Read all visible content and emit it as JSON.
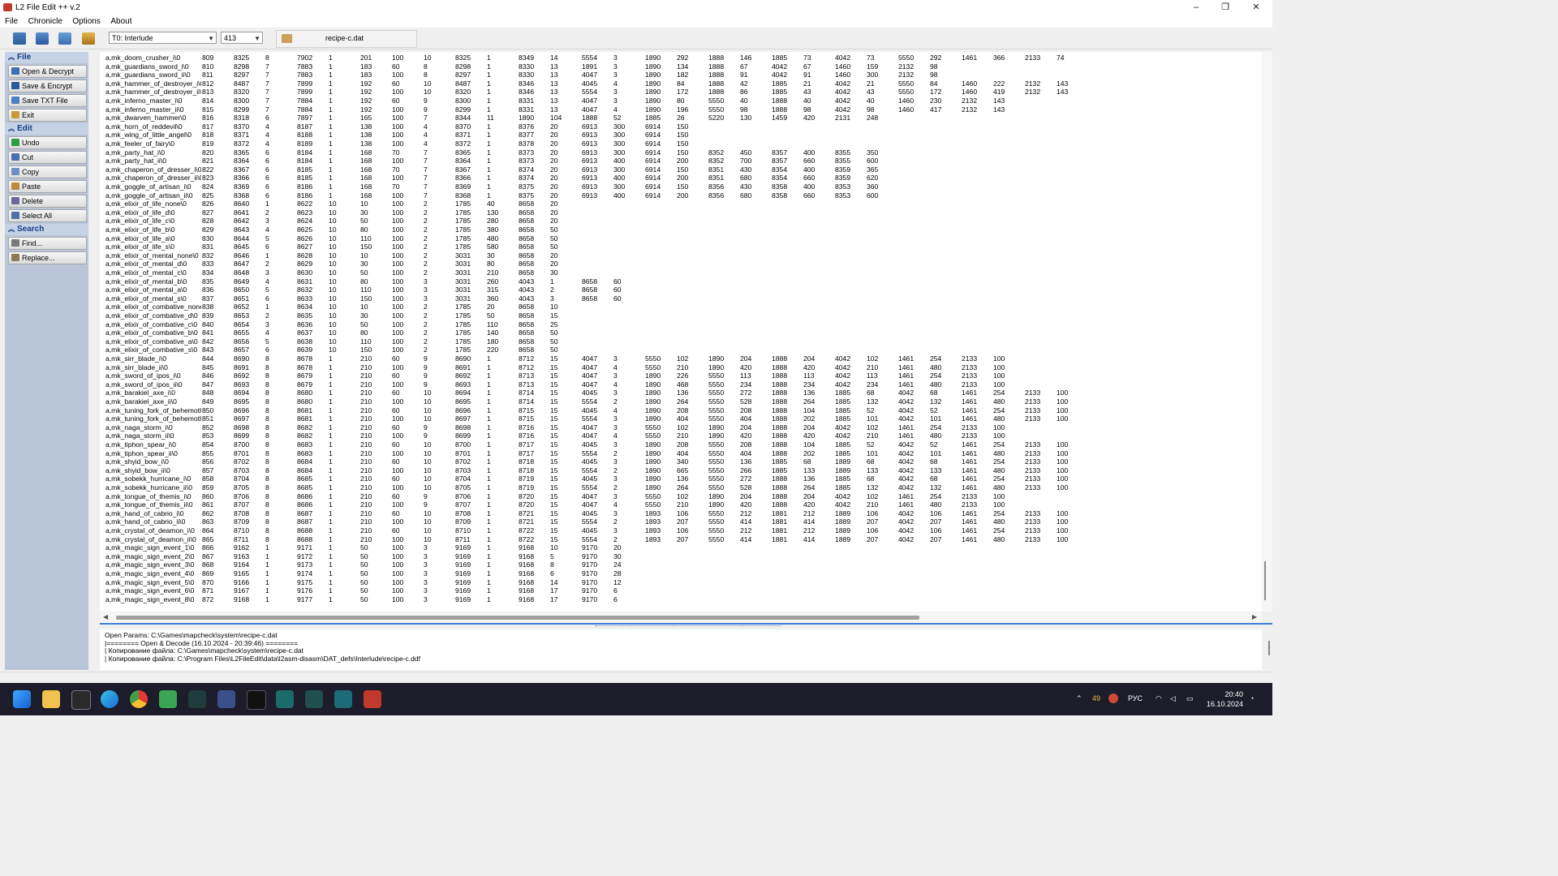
{
  "window": {
    "title": "L2 File Edit ++ v.2",
    "controls": [
      "–",
      "❐",
      "✕"
    ]
  },
  "menu": [
    "File",
    "Chronicle",
    "Options",
    "About"
  ],
  "toolbar": {
    "chronicle_select": "T0: Interlude",
    "count_select": "413",
    "filename": "recipe-c.dat"
  },
  "sidebar": {
    "sections": [
      {
        "title": "File",
        "items": [
          "Open & Decrypt",
          "Save & Encrypt",
          "Save TXT File",
          "Exit"
        ]
      },
      {
        "title": "Edit",
        "items": [
          "Undo",
          "Cut",
          "Copy",
          "Paste",
          "Delete",
          "Select All"
        ]
      },
      {
        "title": "Search",
        "items": [
          "Find...",
          "Replace..."
        ]
      }
    ]
  },
  "rows": [
    "a,mk_doom_crusher_i\\0\t809\t8325\t8\t7902\t1\t201\t100\t10\t8325\t1\t8349\t14\t5554\t3\t1890\t292\t1888\t146\t1885\t73\t4042\t73\t5550\t292\t1461\t366\t2133\t74",
    "a,mk_guardians_sword_i\\0\t810\t8298\t7\t7883\t1\t183\t60\t8\t8298\t1\t8330\t13\t1891\t3\t1890\t134\t1888\t67\t4042\t67\t1460\t159\t2132\t98",
    "a,mk_guardians_sword_ii\\0\t811\t8297\t7\t7883\t1\t183\t100\t8\t8297\t1\t8330\t13\t4047\t3\t1890\t182\t1888\t91\t4042\t91\t1460\t300\t2132\t98",
    "a,mk_hammer_of_destroyer_i\\0\t812\t8487\t7\t7899\t1\t192\t60\t10\t8487\t1\t8346\t13\t4045\t4\t1890\t84\t1888\t42\t1885\t21\t4042\t21\t5550\t84\t1460\t222\t2132\t143",
    "a,mk_hammer_of_destroyer_ii\\0\t813\t8320\t7\t7899\t1\t192\t100\t10\t8320\t1\t8346\t13\t5554\t3\t1890\t172\t1888\t86\t1885\t43\t4042\t43\t5550\t172\t1460\t419\t2132\t143",
    "a,mk_inferno_master_i\\0\t814\t8300\t7\t7884\t1\t192\t60\t9\t8300\t1\t8331\t13\t4047\t3\t1890\t80\t5550\t40\t1888\t40\t4042\t40\t1460\t230\t2132\t143",
    "a,mk_inferno_master_ii\\0\t815\t8299\t7\t7884\t1\t192\t100\t9\t8299\t1\t8331\t13\t4047\t4\t1890\t196\t5550\t98\t1888\t98\t4042\t98\t1460\t417\t2132\t143",
    "a,mk_dwarven_hammer\\0\t816\t8318\t6\t7897\t1\t165\t100\t7\t8344\t11\t1890\t104\t1888\t52\t1885\t26\t5220\t130\t1459\t420\t2131\t248",
    "a,mk_horn_of_reddevil\\0\t817\t8370\t4\t8187\t1\t138\t100\t4\t8370\t1\t8376\t20\t6913\t300\t6914\t150",
    "a,mk_wing_of_little_angel\\0\t818\t8371\t4\t8188\t1\t138\t100\t4\t8371\t1\t8377\t20\t6913\t300\t6914\t150",
    "a,mk_feeler_of_fairy\\0\t819\t8372\t4\t8189\t1\t138\t100\t4\t8372\t1\t8378\t20\t6913\t300\t6914\t150",
    "a,mk_party_hat_i\\0\t820\t8365\t6\t8184\t1\t168\t70\t7\t8365\t1\t8373\t20\t6913\t300\t6914\t150\t8352\t450\t8357\t400\t8355\t350",
    "a,mk_party_hat_ii\\0\t821\t8364\t6\t8184\t1\t168\t100\t7\t8364\t1\t8373\t20\t6913\t400\t6914\t200\t8352\t700\t8357\t660\t8355\t600",
    "a,mk_chaperon_of_dresser_i\\0\t822\t8367\t6\t8185\t1\t168\t70\t7\t8367\t1\t8374\t20\t6913\t300\t6914\t150\t8351\t430\t8354\t400\t8359\t365",
    "a,mk_chaperon_of_dresser_ii\\0\t823\t8366\t6\t8185\t1\t168\t100\t7\t8366\t1\t8374\t20\t6913\t400\t6914\t200\t8351\t680\t8354\t660\t8359\t620",
    "a,mk_goggle_of_artisan_i\\0\t824\t8369\t6\t8186\t1\t168\t70\t7\t8369\t1\t8375\t20\t6913\t300\t6914\t150\t8356\t430\t8358\t400\t8353\t360",
    "a,mk_goggle_of_artisan_ii\\0\t825\t8368\t6\t8186\t1\t168\t100\t7\t8368\t1\t8375\t20\t6913\t400\t6914\t200\t8356\t680\t8358\t660\t8353\t600",
    "a,mk_elixir_of_life_none\\0\t826\t8640\t1\t8622\t10\t10\t100\t2\t1785\t40\t8658\t20",
    "a,mk_elixir_of_life_d\\0\t827\t8641\t2\t8623\t10\t30\t100\t2\t1785\t130\t8658\t20",
    "a,mk_elixir_of_life_c\\0\t828\t8642\t3\t8624\t10\t50\t100\t2\t1785\t280\t8658\t20",
    "a,mk_elixir_of_life_b\\0\t829\t8643\t4\t8625\t10\t80\t100\t2\t1785\t380\t8658\t50",
    "a,mk_elixir_of_life_a\\0\t830\t8644\t5\t8626\t10\t110\t100\t2\t1785\t480\t8658\t50",
    "a,mk_elixir_of_life_s\\0\t831\t8645\t6\t8627\t10\t150\t100\t2\t1785\t580\t8658\t50",
    "a,mk_elixir_of_mental_none\\0\t832\t8646\t1\t8628\t10\t10\t100\t2\t3031\t30\t8658\t20",
    "a,mk_elixir_of_mental_d\\0\t833\t8647\t2\t8629\t10\t30\t100\t2\t3031\t80\t8658\t20",
    "a,mk_elixir_of_mental_c\\0\t834\t8648\t3\t8630\t10\t50\t100\t2\t3031\t210\t8658\t30",
    "a,mk_elixir_of_mental_b\\0\t835\t8649\t4\t8631\t10\t80\t100\t3\t3031\t260\t4043\t1\t8658\t60",
    "a,mk_elixir_of_mental_a\\0\t836\t8650\t5\t8632\t10\t110\t100\t3\t3031\t315\t4043\t2\t8658\t60",
    "a,mk_elixir_of_mental_s\\0\t837\t8651\t6\t8633\t10\t150\t100\t3\t3031\t360\t4043\t3\t8658\t60",
    "a,mk_elixir_of_combative_none\\0\t838\t8652\t1\t8634\t10\t10\t100\t2\t1785\t20\t8658\t10",
    "a,mk_elixir_of_combative_d\\0\t839\t8653\t2\t8635\t10\t30\t100\t2\t1785\t50\t8658\t15",
    "a,mk_elixir_of_combative_c\\0\t840\t8654\t3\t8636\t10\t50\t100\t2\t1785\t110\t8658\t25",
    "a,mk_elixir_of_combative_b\\0\t841\t8655\t4\t8637\t10\t80\t100\t2\t1785\t140\t8658\t50",
    "a,mk_elixir_of_combative_a\\0\t842\t8656\t5\t8638\t10\t110\t100\t2\t1785\t180\t8658\t50",
    "a,mk_elixir_of_combative_s\\0\t843\t8657\t6\t8639\t10\t150\t100\t2\t1785\t220\t8658\t50",
    "a,mk_sirr_blade_i\\0\t844\t8690\t8\t8678\t1\t210\t60\t9\t8690\t1\t8712\t15\t4047\t3\t5550\t102\t1890\t204\t1888\t204\t4042\t102\t1461\t254\t2133\t100",
    "a,mk_sirr_blade_ii\\0\t845\t8691\t8\t8678\t1\t210\t100\t9\t8691\t1\t8712\t15\t4047\t4\t5550\t210\t1890\t420\t1888\t420\t4042\t210\t1461\t480\t2133\t100",
    "a,mk_sword_of_ipos_i\\0\t846\t8692\t8\t8679\t1\t210\t60\t9\t8692\t1\t8713\t15\t4047\t3\t1890\t226\t5550\t113\t1888\t113\t4042\t113\t1461\t254\t2133\t100",
    "a,mk_sword_of_ipos_ii\\0\t847\t8693\t8\t8679\t1\t210\t100\t9\t8693\t1\t8713\t15\t4047\t4\t1890\t468\t5550\t234\t1888\t234\t4042\t234\t1461\t480\t2133\t100",
    "a,mk_barakiel_axe_i\\0\t848\t8694\t8\t8680\t1\t210\t60\t10\t8694\t1\t8714\t15\t4045\t3\t1890\t136\t5550\t272\t1888\t136\t1885\t68\t4042\t68\t1461\t254\t2133\t100",
    "a,mk_barakiel_axe_ii\\0\t849\t8695\t8\t8680\t1\t210\t100\t10\t8695\t1\t8714\t15\t5554\t2\t1890\t264\t5550\t528\t1888\t264\t1885\t132\t4042\t132\t1461\t480\t2133\t100",
    "a,mk_tuning_fork_of_behemoth_i\\0\t850\t8696\t8\t8681\t1\t210\t60\t10\t8696\t1\t8715\t15\t4045\t4\t1890\t208\t5550\t208\t1888\t104\t1885\t52\t4042\t52\t1461\t254\t2133\t100",
    "a,mk_tuning_fork_of_behemoth_ii\\0\t851\t8697\t8\t8681\t1\t210\t100\t10\t8697\t1\t8715\t15\t5554\t3\t1890\t404\t5550\t404\t1888\t202\t1885\t101\t4042\t101\t1461\t480\t2133\t100",
    "a,mk_naga_storm_i\\0\t852\t8698\t8\t8682\t1\t210\t60\t9\t8698\t1\t8716\t15\t4047\t3\t5550\t102\t1890\t204\t1888\t204\t4042\t102\t1461\t254\t2133\t100",
    "a,mk_naga_storm_ii\\0\t853\t8699\t8\t8682\t1\t210\t100\t9\t8699\t1\t8716\t15\t4047\t4\t5550\t210\t1890\t420\t1888\t420\t4042\t210\t1461\t480\t2133\t100",
    "a,mk_tiphon_spear_i\\0\t854\t8700\t8\t8683\t1\t210\t60\t10\t8700\t1\t8717\t15\t4045\t3\t1890\t208\t5550\t208\t1888\t104\t1885\t52\t4042\t52\t1461\t254\t2133\t100",
    "a,mk_tiphon_spear_ii\\0\t855\t8701\t8\t8683\t1\t210\t100\t10\t8701\t1\t8717\t15\t5554\t2\t1890\t404\t5550\t404\t1888\t202\t1885\t101\t4042\t101\t1461\t480\t2133\t100",
    "a,mk_shyid_bow_i\\0\t856\t8702\t8\t8684\t1\t210\t60\t10\t8702\t1\t8718\t15\t4045\t3\t1890\t340\t5550\t136\t1885\t68\t1889\t68\t4042\t68\t1461\t254\t2133\t100",
    "a,mk_shyid_bow_ii\\0\t857\t8703\t8\t8684\t1\t210\t100\t10\t8703\t1\t8718\t15\t5554\t2\t1890\t665\t5550\t266\t1885\t133\t1889\t133\t4042\t133\t1461\t480\t2133\t100",
    "a,mk_sobekk_hurricane_i\\0\t858\t8704\t8\t8685\t1\t210\t60\t10\t8704\t1\t8719\t15\t4045\t3\t1890\t136\t5550\t272\t1888\t136\t1885\t68\t4042\t68\t1461\t254\t2133\t100",
    "a,mk_sobekk_hurricane_ii\\0\t859\t8705\t8\t8685\t1\t210\t100\t10\t8705\t1\t8719\t15\t5554\t2\t1890\t264\t5550\t528\t1888\t264\t1885\t132\t4042\t132\t1461\t480\t2133\t100",
    "a,mk_tongue_of_themis_i\\0\t860\t8706\t8\t8686\t1\t210\t60\t9\t8706\t1\t8720\t15\t4047\t3\t5550\t102\t1890\t204\t1888\t204\t4042\t102\t1461\t254\t2133\t100",
    "a,mk_tongue_of_themis_ii\\0\t861\t8707\t8\t8686\t1\t210\t100\t9\t8707\t1\t8720\t15\t4047\t4\t5550\t210\t1890\t420\t1888\t420\t4042\t210\t1461\t480\t2133\t100",
    "a,mk_hand_of_cabrio_i\\0\t862\t8708\t8\t8687\t1\t210\t60\t10\t8708\t1\t8721\t15\t4045\t3\t1893\t106\t5550\t212\t1881\t212\t1889\t106\t4042\t106\t1461\t254\t2133\t100",
    "a,mk_hand_of_cabrio_ii\\0\t863\t8709\t8\t8687\t1\t210\t100\t10\t8709\t1\t8721\t15\t5554\t2\t1893\t207\t5550\t414\t1881\t414\t1889\t207\t4042\t207\t1461\t480\t2133\t100",
    "a,mk_crystal_of_deamon_i\\0\t864\t8710\t8\t8688\t1\t210\t60\t10\t8710\t1\t8722\t15\t4045\t3\t1893\t106\t5550\t212\t1881\t212\t1889\t106\t4042\t106\t1461\t254\t2133\t100",
    "a,mk_crystal_of_deamon_ii\\0\t865\t8711\t8\t8688\t1\t210\t100\t10\t8711\t1\t8722\t15\t5554\t2\t1893\t207\t5550\t414\t1881\t414\t1889\t207\t4042\t207\t1461\t480\t2133\t100",
    "a,mk_magic_sign_event_1\\0\t866\t9162\t1\t9171\t1\t50\t100\t3\t9169\t1\t9168\t10\t9170\t20",
    "a,mk_magic_sign_event_2\\0\t867\t9163\t1\t9172\t1\t50\t100\t3\t9169\t1\t9168\t5\t9170\t30",
    "a,mk_magic_sign_event_3\\0\t868\t9164\t1\t9173\t1\t50\t100\t3\t9169\t1\t9168\t8\t9170\t24",
    "a,mk_magic_sign_event_4\\0\t869\t9165\t1\t9174\t1\t50\t100\t3\t9169\t1\t9168\t6\t9170\t28",
    "a,mk_magic_sign_event_5\\0\t870\t9166\t1\t9175\t1\t50\t100\t3\t9169\t1\t9168\t14\t9170\t12",
    "a,mk_magic_sign_event_6\\0\t871\t9167\t1\t9176\t1\t50\t100\t3\t9169\t1\t9168\t17\t9170\t6",
    "a,mk_magic_sign_event_8\\0\t872\t9168\t1\t9177\t1\t50\t100\t3\t9169\t1\t9168\t17\t9170\t6"
  ],
  "selected_row": 65,
  "log": [
    "Open Params: C:\\Games\\mapcheck\\system\\recipe-c.dat",
    "|======== Open & Decode (16.10.2024 - 20:39:46) ========",
    "|   Копирование файла: C:\\Games\\mapcheck\\system\\recipe-c.dat",
    "|   Копирование файла: C:\\Program Files\\L2FileEdit\\data\\l2asm-disasm\\DAT_defs\\Interlude\\recipe-c.ddf"
  ],
  "taskbar": {
    "tray_badge": "49",
    "lang": "РУС",
    "time": "20:40",
    "date": "16.10.2024"
  }
}
